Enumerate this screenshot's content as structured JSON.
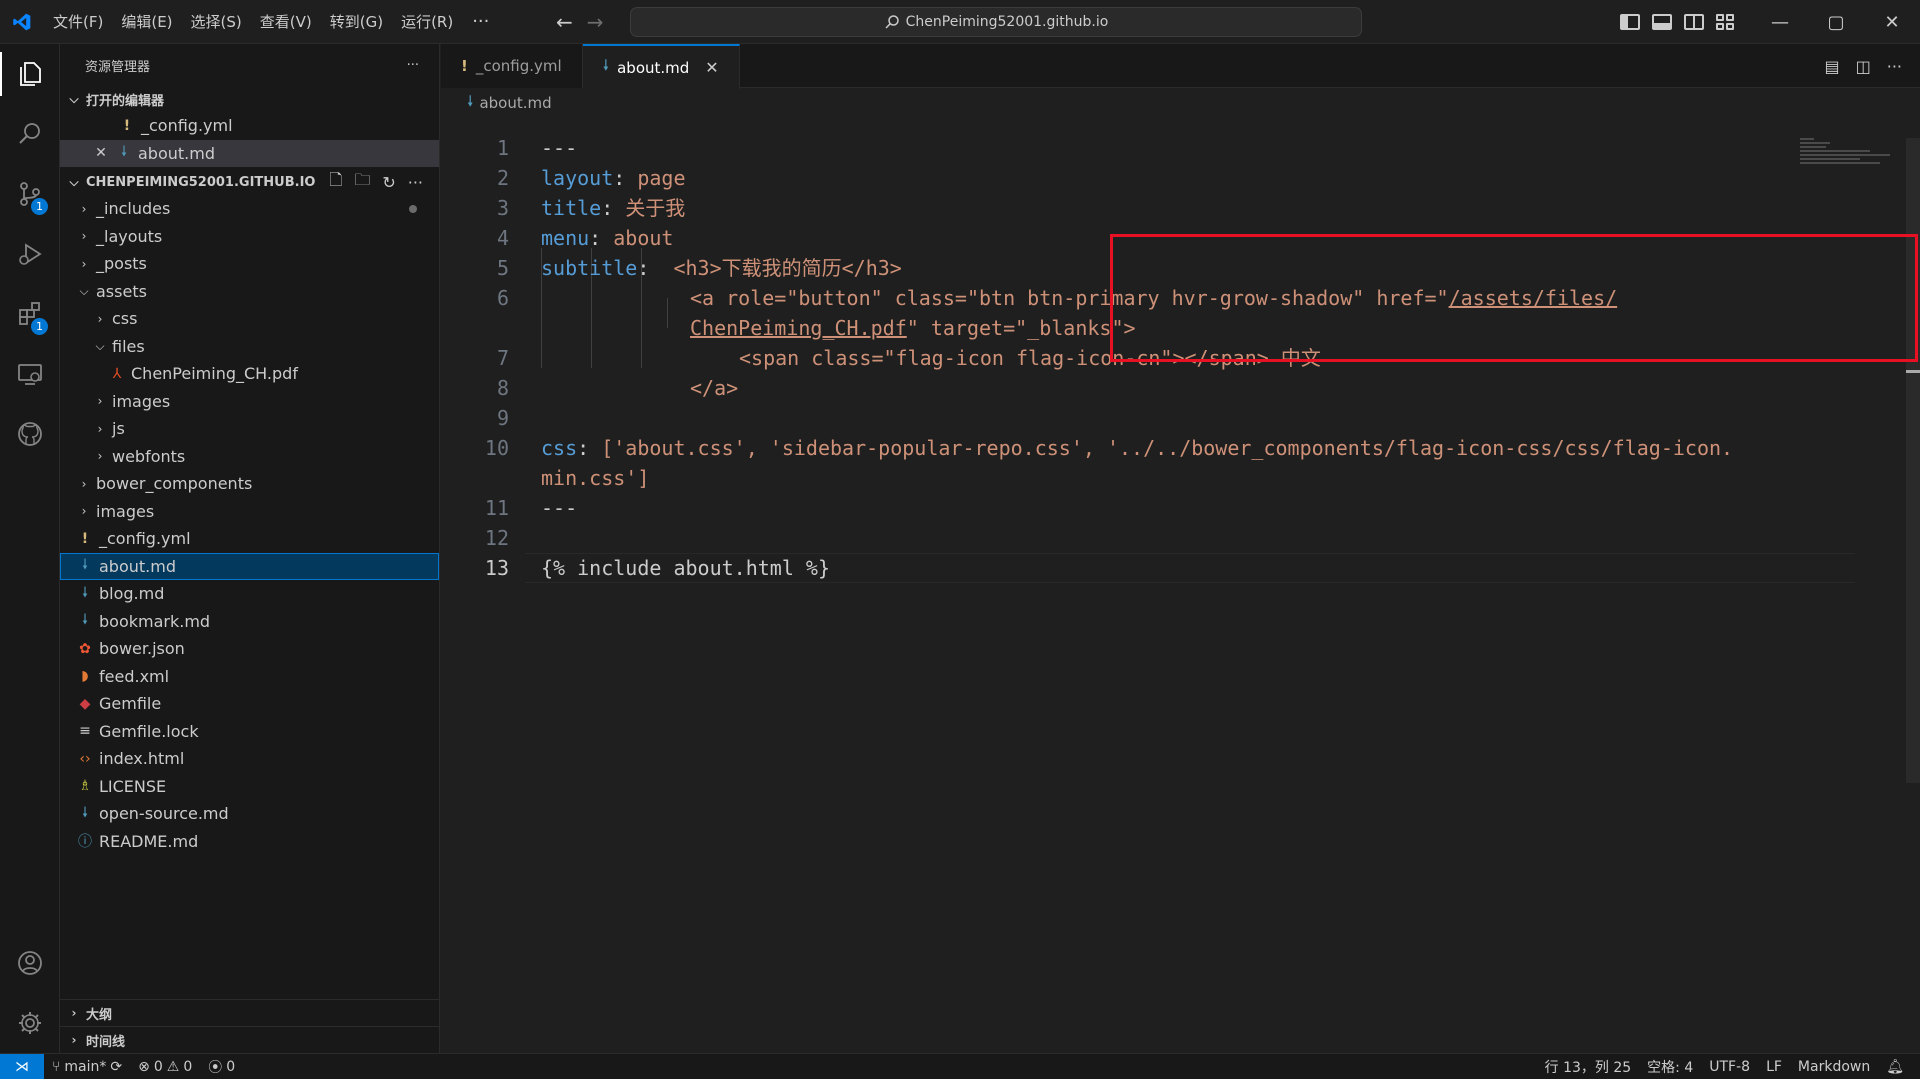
{
  "titlebar": {
    "menu": [
      "文件(F)",
      "编辑(E)",
      "选择(S)",
      "查看(V)",
      "转到(G)",
      "运行(R)"
    ],
    "more": "···",
    "search_text": "ChenPeiming52001.github.io",
    "accent_color": "#0078d4"
  },
  "sidebar": {
    "title": "资源管理器",
    "more": "···",
    "open_editors": {
      "title": "打开的编辑器",
      "items": [
        {
          "label": "_config.yml",
          "icon": "yaml-icon"
        },
        {
          "label": "about.md",
          "icon": "markdown-icon"
        }
      ]
    },
    "explorer": {
      "title": "CHENPEIMING52001.GITHUB.IO",
      "items": [
        {
          "label": "_includes",
          "type": "folder",
          "expanded": false,
          "depth": 0
        },
        {
          "label": "_layouts",
          "type": "folder",
          "expanded": false,
          "depth": 0
        },
        {
          "label": "_posts",
          "type": "folder",
          "expanded": false,
          "depth": 0
        },
        {
          "label": "assets",
          "type": "folder",
          "expanded": true,
          "depth": 0
        },
        {
          "label": "css",
          "type": "folder",
          "expanded": false,
          "depth": 1
        },
        {
          "label": "files",
          "type": "folder",
          "expanded": true,
          "depth": 1
        },
        {
          "label": "ChenPeiming_CH.pdf",
          "type": "pdf",
          "depth": 2
        },
        {
          "label": "images",
          "type": "folder",
          "expanded": false,
          "depth": 1
        },
        {
          "label": "js",
          "type": "folder",
          "expanded": false,
          "depth": 1
        },
        {
          "label": "webfonts",
          "type": "folder",
          "expanded": false,
          "depth": 1
        },
        {
          "label": "bower_components",
          "type": "folder",
          "expanded": false,
          "depth": 0
        },
        {
          "label": "images",
          "type": "folder",
          "expanded": false,
          "depth": 0
        },
        {
          "label": "_config.yml",
          "type": "yaml",
          "depth": 0
        },
        {
          "label": "about.md",
          "type": "md",
          "depth": 0
        },
        {
          "label": "blog.md",
          "type": "md",
          "depth": 0
        },
        {
          "label": "bookmark.md",
          "type": "md",
          "depth": 0
        },
        {
          "label": "bower.json",
          "type": "bower",
          "depth": 0
        },
        {
          "label": "feed.xml",
          "type": "rss",
          "depth": 0
        },
        {
          "label": "Gemfile",
          "type": "gem",
          "depth": 0
        },
        {
          "label": "Gemfile.lock",
          "type": "lock",
          "depth": 0
        },
        {
          "label": "index.html",
          "type": "html",
          "depth": 0
        },
        {
          "label": "LICENSE",
          "type": "license",
          "depth": 0
        },
        {
          "label": "open-source.md",
          "type": "md",
          "depth": 0
        },
        {
          "label": "README.md",
          "type": "info",
          "depth": 0
        }
      ]
    },
    "outline": "大纲",
    "timeline": "时间线"
  },
  "activity": {
    "scm_badge": "1",
    "ext_badge": "1"
  },
  "editor": {
    "tabs": [
      {
        "label": "_config.yml",
        "active": false
      },
      {
        "label": "about.md",
        "active": true
      }
    ],
    "breadcrumb": "about.md",
    "line_numbers": [
      "1",
      "2",
      "3",
      "4",
      "5",
      "6",
      "7",
      "8",
      "9",
      "10",
      "11",
      "12",
      "13"
    ],
    "code": {
      "l1": "---",
      "l2_key": "layout",
      "l2_val": "page",
      "l3_key": "title",
      "l3_val": "关于我",
      "l4_key": "menu",
      "l4_val": "about",
      "l5_key": "subtitle",
      "l5_val": "<h3>下载我的简历</h3>",
      "l6a": "<a role=\"button\" class=\"btn btn-primary hvr-grow-shadow\" href=\"",
      "l6_link1": "/assets/files/",
      "l6_link2": "ChenPeiming_CH.pdf",
      "l6b": "\" target=\"_blanks\">",
      "l7": "<span class=\"flag-icon flag-icon-cn\"></span> 中文",
      "l8": "</a>",
      "l10_key": "css",
      "l10_val": "['about.css', 'sidebar-popular-repo.css', '../../bower_components/flag-icon-css/css/flag-icon.",
      "l10_wrap": "min.css']",
      "l11": "---",
      "l13": "{% include about.html %}"
    }
  },
  "statusbar": {
    "branch": "main*",
    "errors": "0",
    "warnings": "0",
    "ports": "0",
    "position": "行 13，列 25",
    "indent": "空格: 4",
    "encoding": "UTF-8",
    "eol": "LF",
    "language": "Markdown"
  }
}
